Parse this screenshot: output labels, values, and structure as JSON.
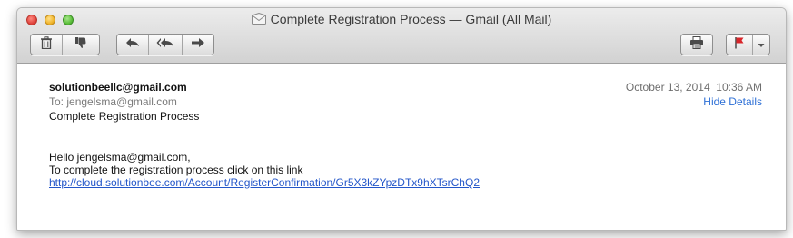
{
  "window": {
    "title": "Complete Registration Process — Gmail (All Mail)"
  },
  "toolbar": {
    "left_group": [
      {
        "name": "delete-button",
        "icon": "trash-icon"
      },
      {
        "name": "junk-button",
        "icon": "thumbs-down-icon"
      }
    ],
    "reply_group": [
      {
        "name": "reply-button",
        "icon": "reply-arrow-icon"
      },
      {
        "name": "reply-all-button",
        "icon": "reply-all-arrow-icon"
      },
      {
        "name": "forward-button",
        "icon": "forward-arrow-icon"
      }
    ],
    "right": [
      {
        "name": "print-button",
        "icon": "printer-icon"
      },
      {
        "name": "flag-button",
        "icon": "flag-icon"
      },
      {
        "name": "flag-menu-button",
        "icon": "chevron-down-icon"
      }
    ]
  },
  "message": {
    "from": "solutionbeellc@gmail.com",
    "to_label": "To:",
    "to": "jengelsma@gmail.com",
    "subject": "Complete Registration Process",
    "date": "October 13, 2014  10:36 AM",
    "hide_details": "Hide Details",
    "body_line1": "Hello jengelsma@gmail.com,",
    "body_line2": "To complete the registration process click on this link",
    "link": "http://cloud.solutionbee.com/Account/RegisterConfirmation/Gr5X3kZYpzDTx9hXTsrChQ2"
  },
  "colors": {
    "link": "#2356c9",
    "hide_details": "#2d6fd6",
    "flag": "#d8262b",
    "close": "#e0443e",
    "minimize": "#f0b52d",
    "zoom": "#5cbf3b"
  }
}
